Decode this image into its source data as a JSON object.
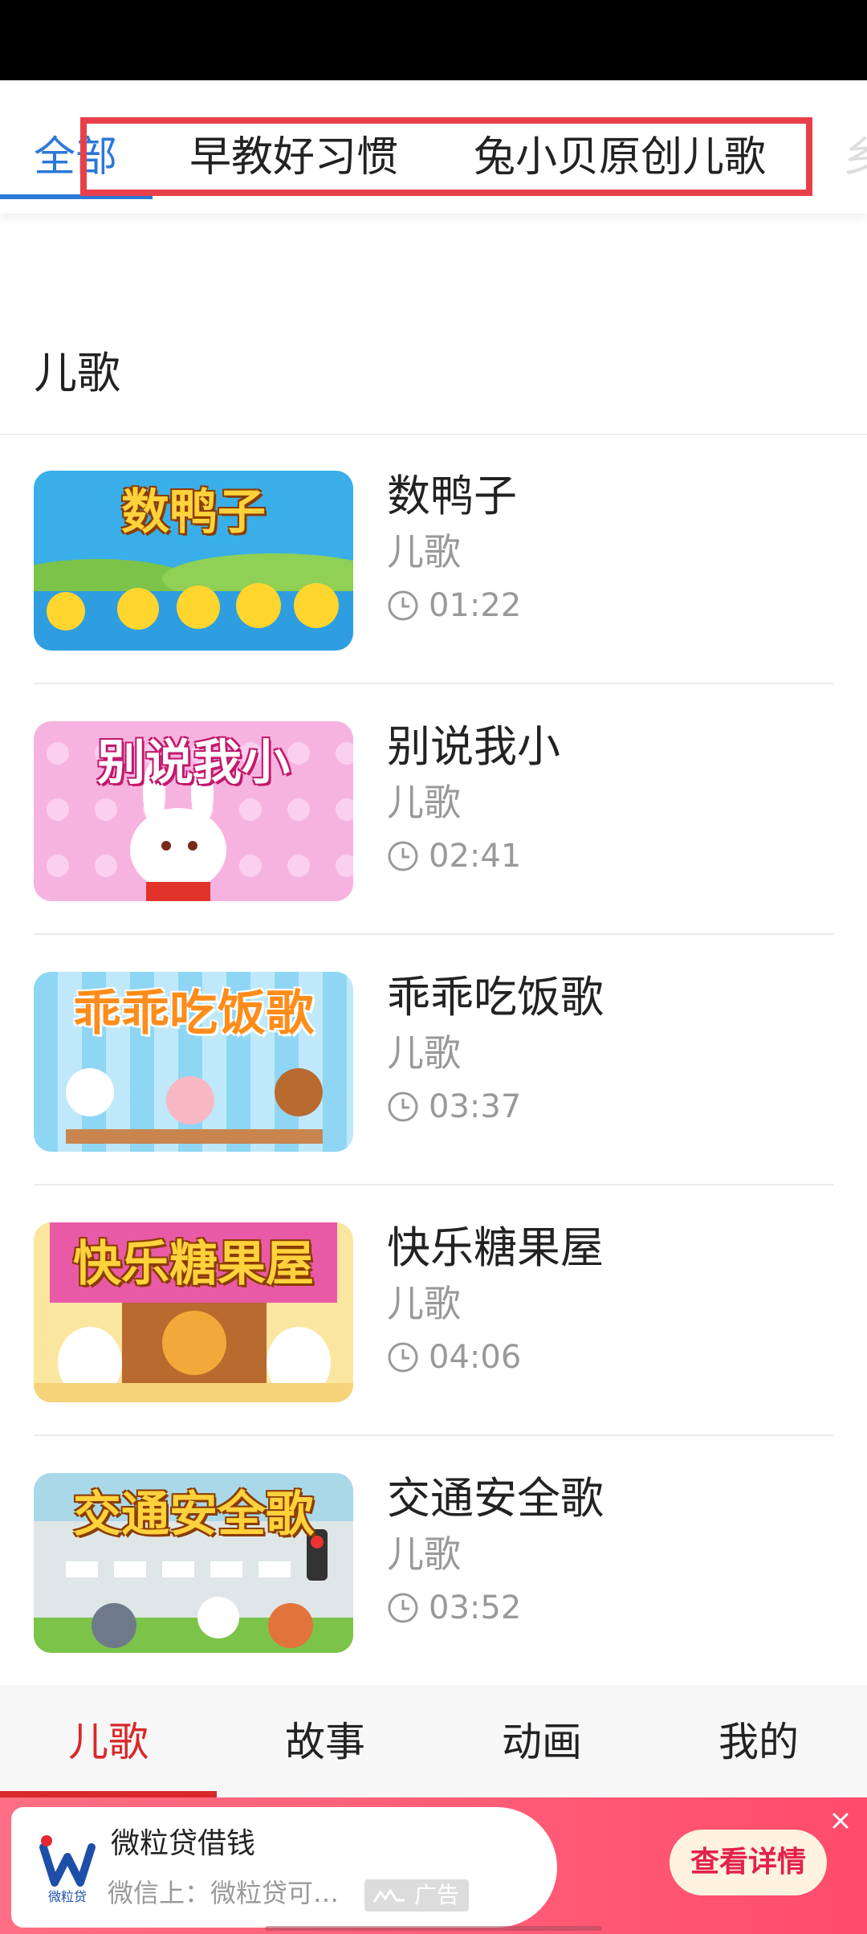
{
  "tabs": {
    "items": [
      {
        "label": "全部"
      },
      {
        "label": "早教好习惯"
      },
      {
        "label": "兔小贝原创儿歌"
      },
      {
        "label": "乡"
      }
    ]
  },
  "section": {
    "title": "儿歌"
  },
  "songs": [
    {
      "title": "数鸭子",
      "category": "儿歌",
      "duration": "01:22",
      "thumb_text": "数鸭子"
    },
    {
      "title": "别说我小",
      "category": "儿歌",
      "duration": "02:41",
      "thumb_text": "别说我小"
    },
    {
      "title": "乖乖吃饭歌",
      "category": "儿歌",
      "duration": "03:37",
      "thumb_text": "乖乖吃饭歌"
    },
    {
      "title": "快乐糖果屋",
      "category": "儿歌",
      "duration": "04:06",
      "thumb_text": "快乐糖果屋"
    },
    {
      "title": "交通安全歌",
      "category": "儿歌",
      "duration": "03:52",
      "thumb_text": "交通安全歌"
    }
  ],
  "bottom_nav": {
    "items": [
      {
        "label": "儿歌"
      },
      {
        "label": "故事"
      },
      {
        "label": "动画"
      },
      {
        "label": "我的"
      }
    ]
  },
  "ad": {
    "logo_text": "微粒贷",
    "title": "微粒贷借钱",
    "description": "微信上：微粒贷可…",
    "badge": "广告",
    "button": "查看详情"
  },
  "colors": {
    "accent_blue": "#2b78d8",
    "accent_red": "#d8282a",
    "highlight_box": "#e8404a",
    "ad_background": "#ff5b76"
  }
}
